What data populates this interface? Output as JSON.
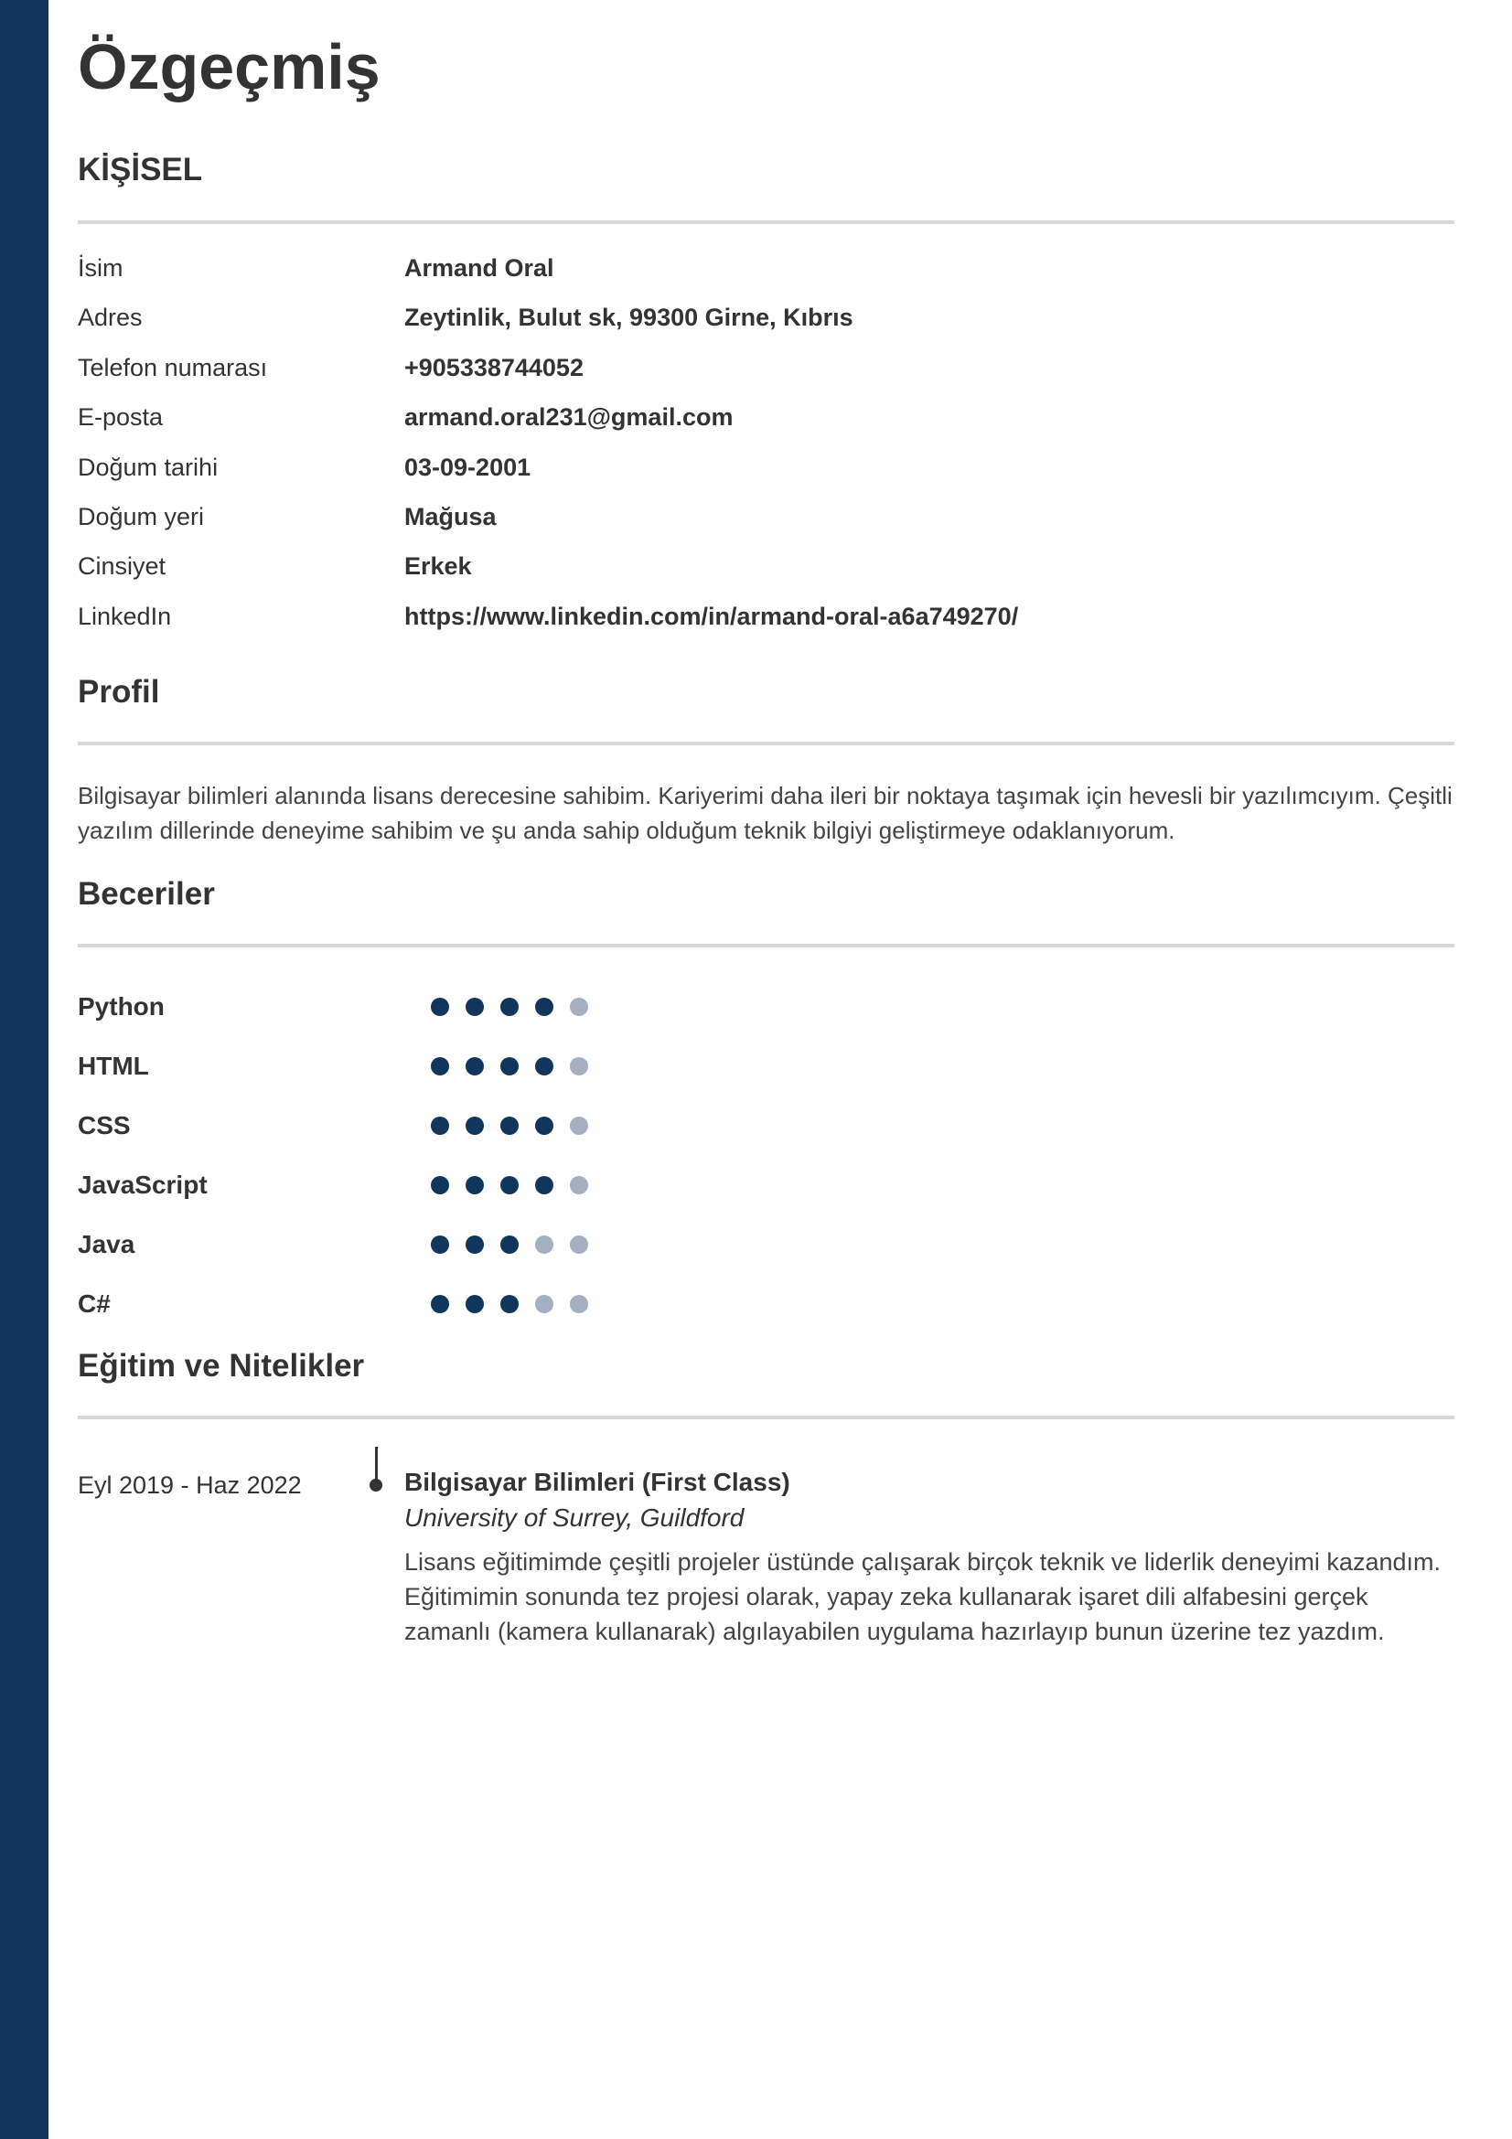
{
  "colors": {
    "accent": "#11355b",
    "dot_filled": "#11355b",
    "dot_empty": "#a3b0c2",
    "divider": "#d8d8d8",
    "text": "#333333"
  },
  "title": "Özgeçmiş",
  "personal": {
    "heading": "KİŞİSEL",
    "rows": [
      {
        "label": "İsim",
        "value": "Armand Oral"
      },
      {
        "label": "Adres",
        "value": "Zeytinlik, Bulut sk, 99300 Girne, Kıbrıs"
      },
      {
        "label": "Telefon numarası",
        "value": "+905338744052"
      },
      {
        "label": "E-posta",
        "value": "armand.oral231@gmail.com"
      },
      {
        "label": "Doğum tarihi",
        "value": "03-09-2001"
      },
      {
        "label": "Doğum yeri",
        "value": "Mağusa"
      },
      {
        "label": "Cinsiyet",
        "value": "Erkek"
      },
      {
        "label": "LinkedIn",
        "value": "https://www.linkedin.com/in/armand-oral-a6a749270/"
      }
    ]
  },
  "profile": {
    "heading": "Profil",
    "text": "Bilgisayar bilimleri alanında lisans derecesine sahibim. Kariyerimi daha ileri bir noktaya taşımak için hevesli bir yazılımcıyım. Çeşitli yazılım dillerinde deneyime sahibim ve şu anda sahip olduğum teknik bilgiyi geliştirmeye odaklanıyorum."
  },
  "skills": {
    "heading": "Beceriler",
    "max_level": 5,
    "items": [
      {
        "name": "Python",
        "level": 4
      },
      {
        "name": "HTML",
        "level": 4
      },
      {
        "name": "CSS",
        "level": 4
      },
      {
        "name": "JavaScript",
        "level": 4
      },
      {
        "name": "Java",
        "level": 3
      },
      {
        "name": "C#",
        "level": 3
      }
    ]
  },
  "education": {
    "heading": "Eğitim ve Nitelikler",
    "entries": [
      {
        "dates": "Eyl 2019 - Haz 2022",
        "degree": "Bilgisayar Bilimleri (First Class)",
        "school": "University of Surrey, Guildford",
        "description": "Lisans eğitimimde çeşitli projeler üstünde çalışarak birçok teknik ve liderlik deneyimi kazandım. Eğitimimin sonunda tez projesi olarak, yapay zeka kullanarak işaret dili alfabesini gerçek zamanlı (kamera kullanarak) algılayabilen uygulama hazırlayıp bunun üzerine tez yazdım."
      }
    ]
  }
}
